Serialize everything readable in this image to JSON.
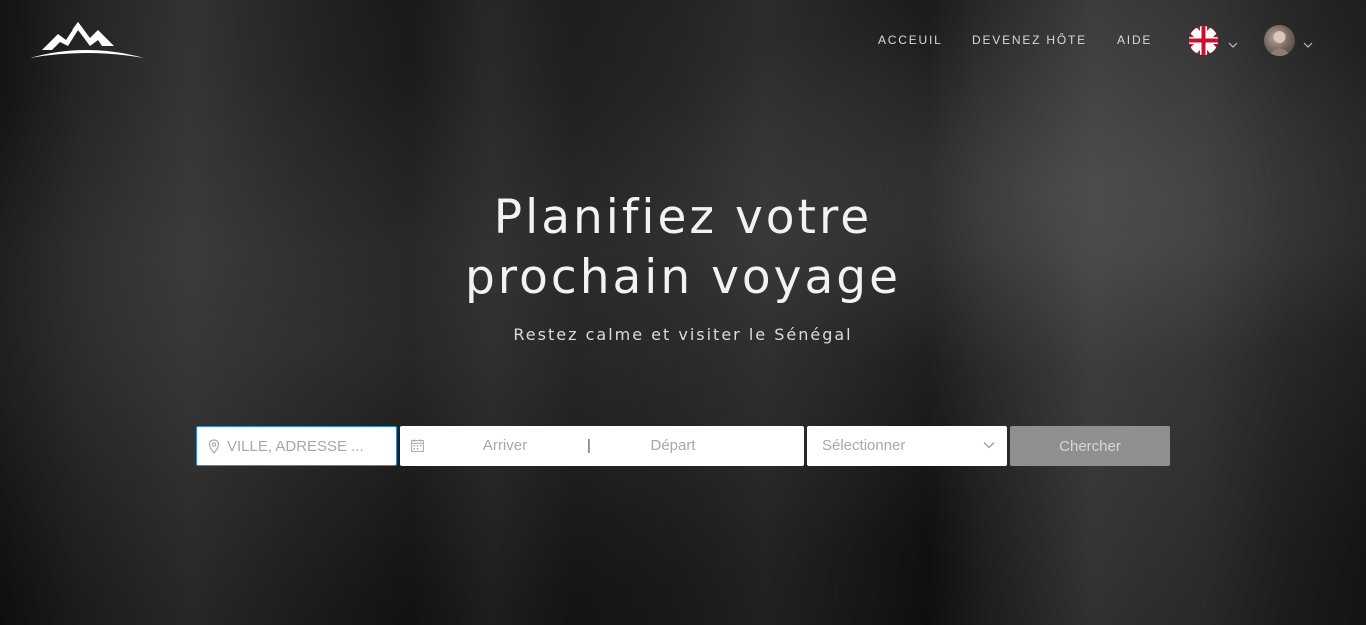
{
  "header": {
    "logo_icon": "mountain-logo-icon",
    "nav": [
      {
        "label": "ACCEUIL"
      },
      {
        "label": "DEVENEZ HÔTE"
      },
      {
        "label": "AIDE"
      }
    ],
    "language_icon": "uk-flag-icon",
    "user_icon": "user-avatar"
  },
  "hero": {
    "title_line1": "Planifiez votre",
    "title_line2": "prochain voyage",
    "subtitle": "Restez calme et visiter le Sénégal"
  },
  "search": {
    "location_placeholder": "VILLE, ADRESSE ...",
    "arrive_label": "Arriver",
    "separator": "|",
    "depart_label": "Départ",
    "select_value": "Sélectionner",
    "button_label": "Chercher"
  },
  "colors": {
    "accent_border": "#2a8fd6",
    "button_bg": "#8f8f8f",
    "text_light": "#f2f2f2"
  }
}
